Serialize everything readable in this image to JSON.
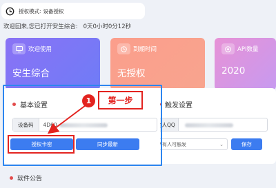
{
  "auth": {
    "label": "授权模式:",
    "value": "设备授权"
  },
  "welcome": {
    "message": "欢迎回来,您已打开安生综合:",
    "elapsed": "0天0小时0分12秒"
  },
  "cards": [
    {
      "icon": "screen-icon",
      "title": "欢迎使用",
      "value": "安生综合"
    },
    {
      "icon": "clock-icon",
      "title": "到期时间",
      "value": "无授权"
    },
    {
      "icon": "api-icon",
      "title": "API数量",
      "value": "2020"
    }
  ],
  "basic": {
    "title": "基本设置",
    "code_label": "设备码",
    "code_value": "4D60",
    "auth_button": "授权卡密",
    "sync_button": "同步最新"
  },
  "trigger": {
    "title": "触发设置",
    "owner_label": "主人QQ",
    "select_value": "所有人可触发",
    "save_button": "保存"
  },
  "annotation": {
    "step_number": "1",
    "step_label": "第一步"
  },
  "bottom": {
    "title": "软件公告"
  },
  "colors": {
    "accent": "#3c7cf0",
    "annotation_red": "#e3231f",
    "frame_blue": "#2d86f0"
  }
}
